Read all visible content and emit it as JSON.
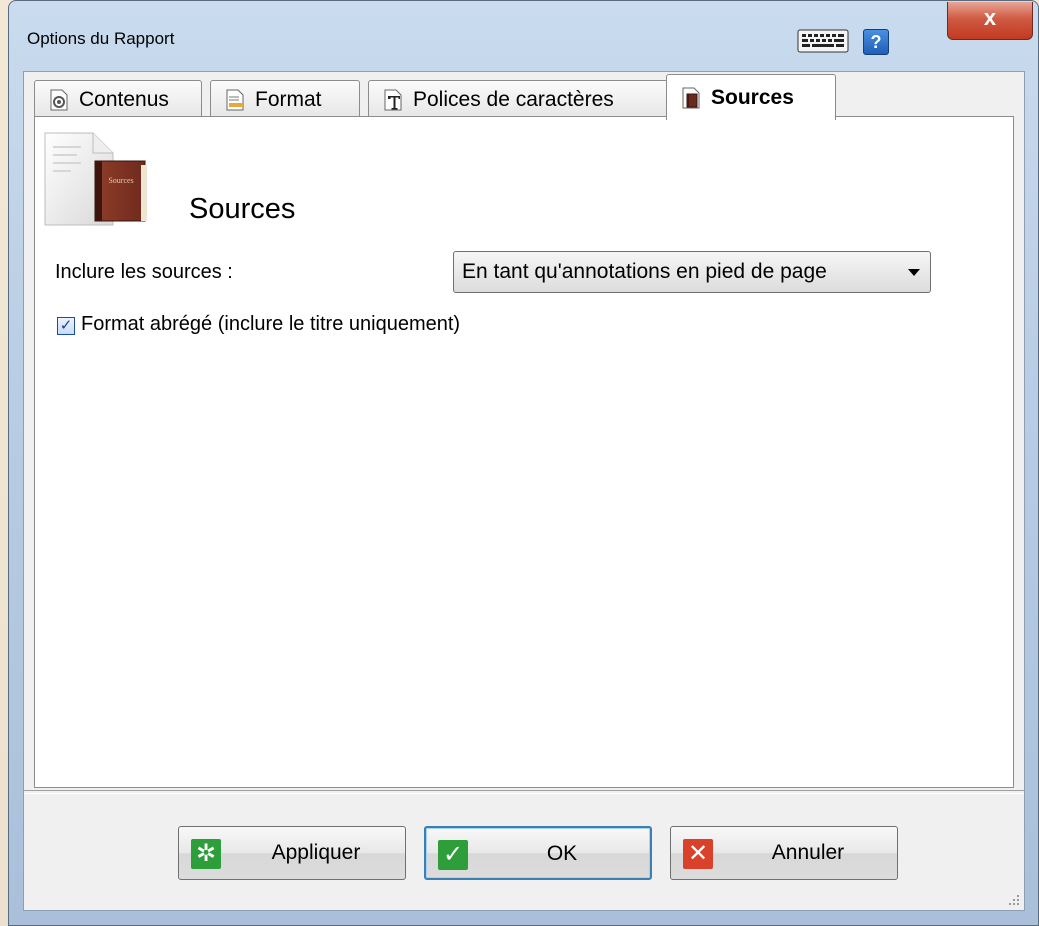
{
  "window": {
    "title": "Options du Rapport",
    "keyboard_icon": "keyboard-icon",
    "help_label": "?",
    "close_label": "x"
  },
  "tabs": [
    {
      "label": "Contenus",
      "icon": "gear-document-icon"
    },
    {
      "label": "Format",
      "icon": "format-icon"
    },
    {
      "label": "Polices de caractères",
      "icon": "font-icon"
    },
    {
      "label": "Sources",
      "icon": "book-icon",
      "active": true
    }
  ],
  "sources_panel": {
    "title": "Sources",
    "book_cover_text": "Sources",
    "include_label": "Inclure les sources :",
    "include_value": "En tant qu'annotations en pied de page",
    "short_format_label": "Format abrégé (inclure le titre uniquement)",
    "short_format_checked": true
  },
  "buttons": {
    "apply": "Appliquer",
    "ok": "OK",
    "cancel": "Annuler"
  },
  "colors": {
    "apply_icon": "#2e9e3a",
    "ok_icon": "#2e9e3a",
    "cancel_icon": "#d9412b",
    "default_button_border": "#3c7fb1"
  }
}
